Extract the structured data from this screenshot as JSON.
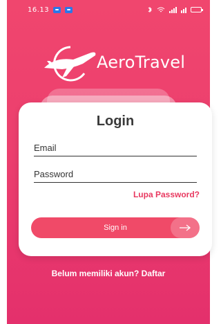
{
  "status_bar": {
    "time": "16.13"
  },
  "brand": {
    "name": "AeroTravel"
  },
  "login": {
    "title": "Login",
    "email_placeholder": "Email",
    "password_placeholder": "Password",
    "forgot_label": "Lupa Password?",
    "signin_label": "Sign in"
  },
  "footer": {
    "register_label": "Belum memiliki akun? Daftar"
  },
  "colors": {
    "accent": "#ec3f6e",
    "button": "#f04a68",
    "link": "#e8385f"
  }
}
